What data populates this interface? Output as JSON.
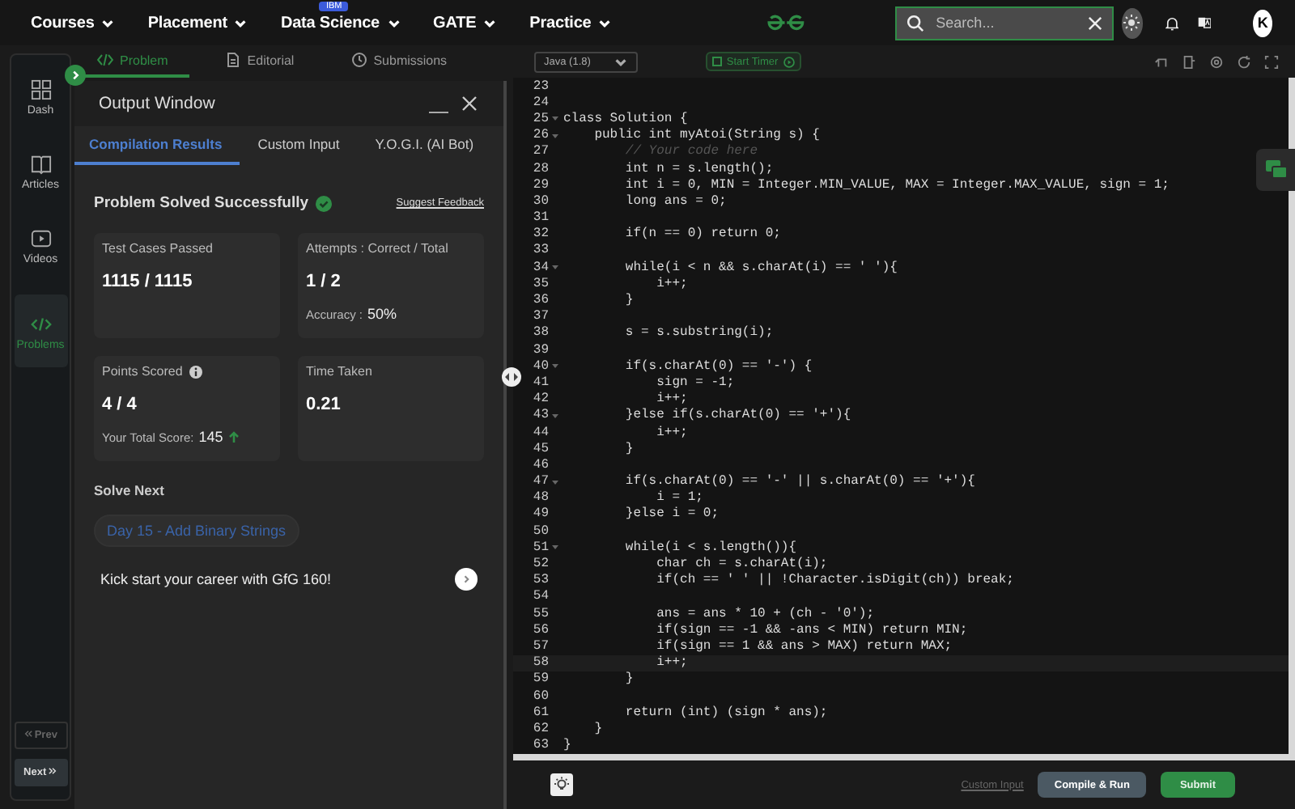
{
  "nav": {
    "menus": [
      {
        "label": "Courses"
      },
      {
        "label": "Placement"
      },
      {
        "label": "Data Science",
        "badge": "IBM"
      },
      {
        "label": "GATE"
      },
      {
        "label": "Practice"
      }
    ],
    "search": {
      "placeholder": "Search..."
    },
    "avatar": "K"
  },
  "sidebar": {
    "items": [
      {
        "label": "Dash",
        "kind": "grid",
        "selected": false
      },
      {
        "label": "Articles",
        "kind": "book",
        "selected": false
      },
      {
        "label": "Videos",
        "kind": "video",
        "selected": false
      },
      {
        "label": "Problems",
        "kind": "code",
        "selected": true
      }
    ],
    "prev": {
      "label": "Prev",
      "disabled": true
    },
    "next": {
      "label": "Next",
      "disabled": false
    }
  },
  "problem_tabs": [
    {
      "label": "Problem",
      "kind": "code",
      "selected": true
    },
    {
      "label": "Editorial",
      "kind": "doc",
      "selected": false
    },
    {
      "label": "Submissions",
      "kind": "clock",
      "selected": false
    }
  ],
  "output_window": {
    "title": "Output Window",
    "tabs": [
      {
        "label": "Compilation Results",
        "selected": true
      },
      {
        "label": "Custom Input",
        "selected": false
      },
      {
        "label": "Y.O.G.I. (AI Bot)",
        "selected": false
      }
    ],
    "result": {
      "heading": "Problem Solved Successfully",
      "feedback_link": "Suggest Feedback"
    },
    "cards": [
      {
        "label": "Test Cases Passed",
        "value": "1115 / 1115"
      },
      {
        "label": "Attempts : Correct / Total",
        "value": "1 / 2",
        "note_label": "Accuracy :",
        "note_value": "50%"
      },
      {
        "label": "Points Scored",
        "info": true,
        "value": "4 / 4",
        "note_label": "Your Total Score:",
        "note_value": "145",
        "trend_up": true
      },
      {
        "label": "Time Taken",
        "value": "0.21"
      }
    ],
    "solve_next": {
      "heading": "Solve Next",
      "problem": "Day 15 - Add Binary Strings",
      "promo": "Kick start your career with GfG 160!"
    }
  },
  "editor": {
    "language": "Java (1.8)",
    "timer": "Start Timer",
    "lines": [
      {
        "no": "23"
      },
      {
        "no": "24"
      },
      {
        "no": "25",
        "text": "class Solution {",
        "fold": true
      },
      {
        "no": "26",
        "text": "    public int myAtoi(String s) {",
        "fold": true
      },
      {
        "no": "27",
        "text": "        // Your code here",
        "kind": "comment"
      },
      {
        "no": "28",
        "text": "        int n = s.length();"
      },
      {
        "no": "29",
        "text": "        int i = 0, MIN = Integer.MIN_VALUE, MAX = Integer.MAX_VALUE, sign = 1;"
      },
      {
        "no": "30",
        "text": "        long ans = 0;"
      },
      {
        "no": "31"
      },
      {
        "no": "32",
        "text": "        if(n == 0) return 0;"
      },
      {
        "no": "33"
      },
      {
        "no": "34",
        "text": "        while(i < n && s.charAt(i) == ' '){",
        "fold": true
      },
      {
        "no": "35",
        "text": "            i++;"
      },
      {
        "no": "36",
        "text": "        }"
      },
      {
        "no": "37"
      },
      {
        "no": "38",
        "text": "        s = s.substring(i);"
      },
      {
        "no": "39"
      },
      {
        "no": "40",
        "text": "        if(s.charAt(0) == '-') {",
        "fold": true
      },
      {
        "no": "41",
        "text": "            sign = -1;"
      },
      {
        "no": "42",
        "text": "            i++;"
      },
      {
        "no": "43",
        "text": "        }else if(s.charAt(0) == '+'){",
        "fold": true
      },
      {
        "no": "44",
        "text": "            i++;"
      },
      {
        "no": "45",
        "text": "        }"
      },
      {
        "no": "46"
      },
      {
        "no": "47",
        "text": "        if(s.charAt(0) == '-' || s.charAt(0) == '+'){",
        "fold": true
      },
      {
        "no": "48",
        "text": "            i = 1;"
      },
      {
        "no": "49",
        "text": "        }else i = 0;"
      },
      {
        "no": "50"
      },
      {
        "no": "51",
        "text": "        while(i < s.length()){",
        "fold": true
      },
      {
        "no": "52",
        "text": "            char ch = s.charAt(i);"
      },
      {
        "no": "53",
        "text": "            if(ch == ' ' || !Character.isDigit(ch)) break;"
      },
      {
        "no": "54"
      },
      {
        "no": "55",
        "text": "            ans = ans * 10 + (ch - '0');"
      },
      {
        "no": "56",
        "text": "            if(sign == -1 && -ans < MIN) return MIN;"
      },
      {
        "no": "57",
        "text": "            if(sign == 1 && ans > MAX) return MAX;"
      },
      {
        "no": "58",
        "text": "            i++;",
        "active": true
      },
      {
        "no": "59",
        "text": "        }"
      },
      {
        "no": "60"
      },
      {
        "no": "61",
        "text": "        return (int) (sign * ans);"
      },
      {
        "no": "62",
        "text": "    }"
      },
      {
        "no": "63",
        "text": "}"
      }
    ],
    "custom_input": "Custom Input",
    "compile": "Compile & Run",
    "submit": "Submit"
  }
}
